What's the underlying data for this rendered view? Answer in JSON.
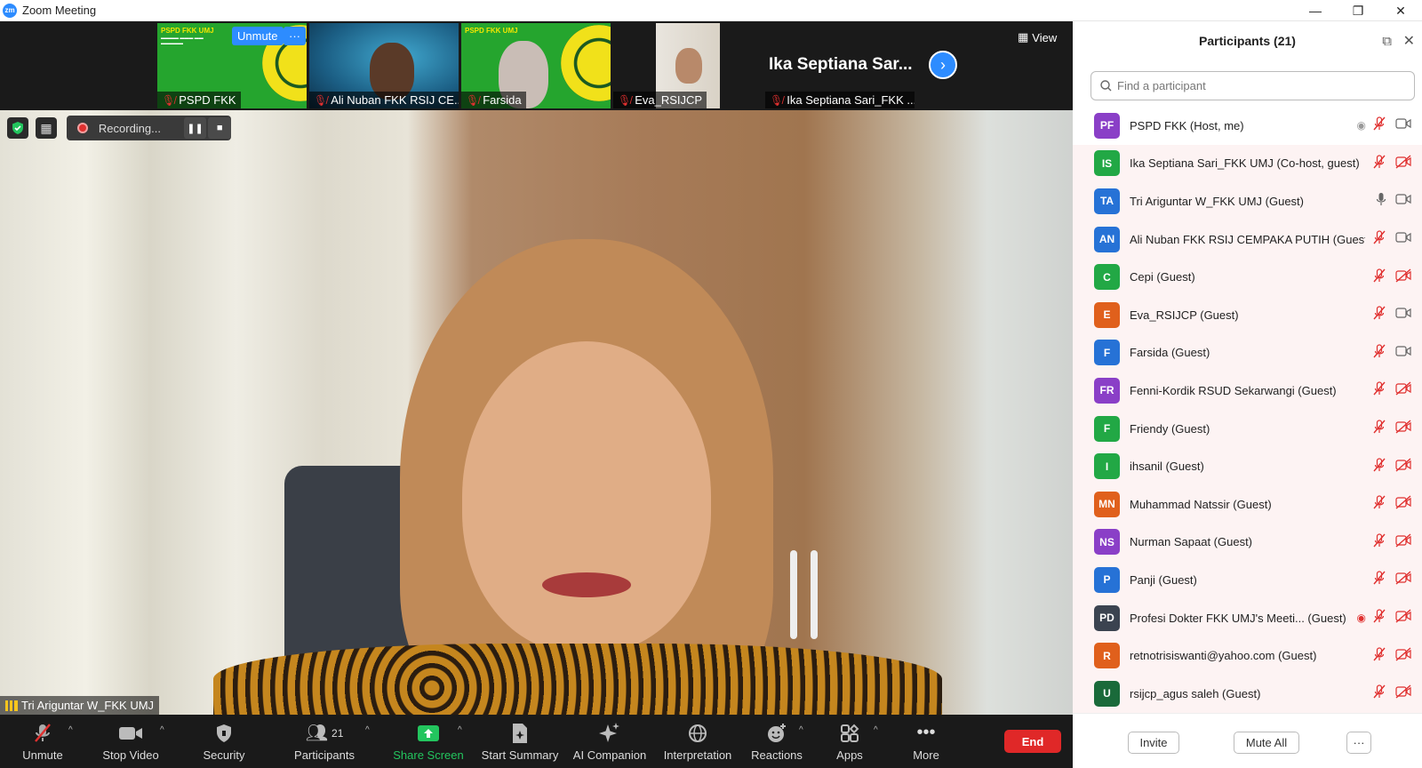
{
  "window": {
    "title": "Zoom Meeting",
    "logo": "zm"
  },
  "thumbnails": [
    {
      "name": "PSPD FKK",
      "slide_header": "PSPD FKK UMJ",
      "overlay_unmute": "Unmute",
      "overlay_more": "···"
    },
    {
      "name": "Ali Nuban FKK RSIJ CE..."
    },
    {
      "name": "Farsida",
      "slide_header": "PSPD FKK UMJ"
    },
    {
      "name": "Eva_RSIJCP"
    },
    {
      "name": "Ika Septiana Sari_FKK ...",
      "big_label": "Ika Septiana Sar..."
    }
  ],
  "view_button": "View",
  "recording": {
    "label": "Recording...",
    "pause": "❚❚",
    "stop": "■"
  },
  "active_speaker": "Tri Ariguntar W_FKK UMJ",
  "toolbar": {
    "unmute": "Unmute",
    "stop_video": "Stop Video",
    "security": "Security",
    "participants": "Participants",
    "participants_count": "21",
    "share_screen": "Share Screen",
    "start_summary": "Start Summary",
    "ai_companion": "AI Companion",
    "interpretation": "Interpretation",
    "reactions": "Reactions",
    "apps": "Apps",
    "more": "More",
    "end": "End"
  },
  "panel": {
    "title": "Participants (21)",
    "search_placeholder": "Find a participant",
    "invite": "Invite",
    "mute_all": "Mute All",
    "more": "···",
    "participants": [
      {
        "initials": "PF",
        "color": "#8a3fc7",
        "name": "PSPD FKK (Host, me)",
        "mic": "off",
        "cam": "on",
        "rec": true
      },
      {
        "initials": "IS",
        "color": "#22a845",
        "name": "Ika Septiana Sari_FKK UMJ (Co-host, guest)",
        "mic": "off",
        "cam": "off"
      },
      {
        "initials": "TA",
        "color": "#2672d6",
        "name": "Tri Ariguntar W_FKK UMJ (Guest)",
        "mic": "on",
        "cam": "on"
      },
      {
        "initials": "AN",
        "color": "#2672d6",
        "name": "Ali Nuban FKK RSIJ CEMPAKA PUTIH (Guest)",
        "mic": "off",
        "cam": "on"
      },
      {
        "initials": "C",
        "color": "#22a845",
        "name": "Cepi (Guest)",
        "mic": "off",
        "cam": "off"
      },
      {
        "initials": "E",
        "color": "#e0601c",
        "name": "Eva_RSIJCP (Guest)",
        "mic": "off",
        "cam": "on"
      },
      {
        "initials": "F",
        "color": "#2672d6",
        "name": "Farsida (Guest)",
        "mic": "off",
        "cam": "on"
      },
      {
        "initials": "FR",
        "color": "#8a3fc7",
        "name": "Fenni-Kordik RSUD Sekarwangi (Guest)",
        "mic": "off",
        "cam": "off"
      },
      {
        "initials": "F",
        "color": "#22a845",
        "name": "Friendy (Guest)",
        "mic": "off",
        "cam": "off"
      },
      {
        "initials": "I",
        "color": "#22a845",
        "name": "ihsanil (Guest)",
        "mic": "off",
        "cam": "off"
      },
      {
        "initials": "MN",
        "color": "#e0601c",
        "name": "Muhammad Natssir (Guest)",
        "mic": "off",
        "cam": "off"
      },
      {
        "initials": "NS",
        "color": "#8a3fc7",
        "name": "Nurman Sapaat (Guest)",
        "mic": "off",
        "cam": "off"
      },
      {
        "initials": "P",
        "color": "#2672d6",
        "name": "Panji (Guest)",
        "mic": "off",
        "cam": "off"
      },
      {
        "initials": "PD",
        "color": "#3b4350",
        "name": "Profesi Dokter FKK UMJ's Meeti...  (Guest)",
        "mic": "off",
        "cam": "off",
        "rec": true
      },
      {
        "initials": "R",
        "color": "#e0601c",
        "name": "retnotrisiswanti@yahoo.com (Guest)",
        "mic": "off",
        "cam": "off"
      },
      {
        "initials": "U",
        "color": "#1a6a3a",
        "name": "rsijcp_agus saleh (Guest)",
        "mic": "off",
        "cam": "off"
      }
    ]
  }
}
